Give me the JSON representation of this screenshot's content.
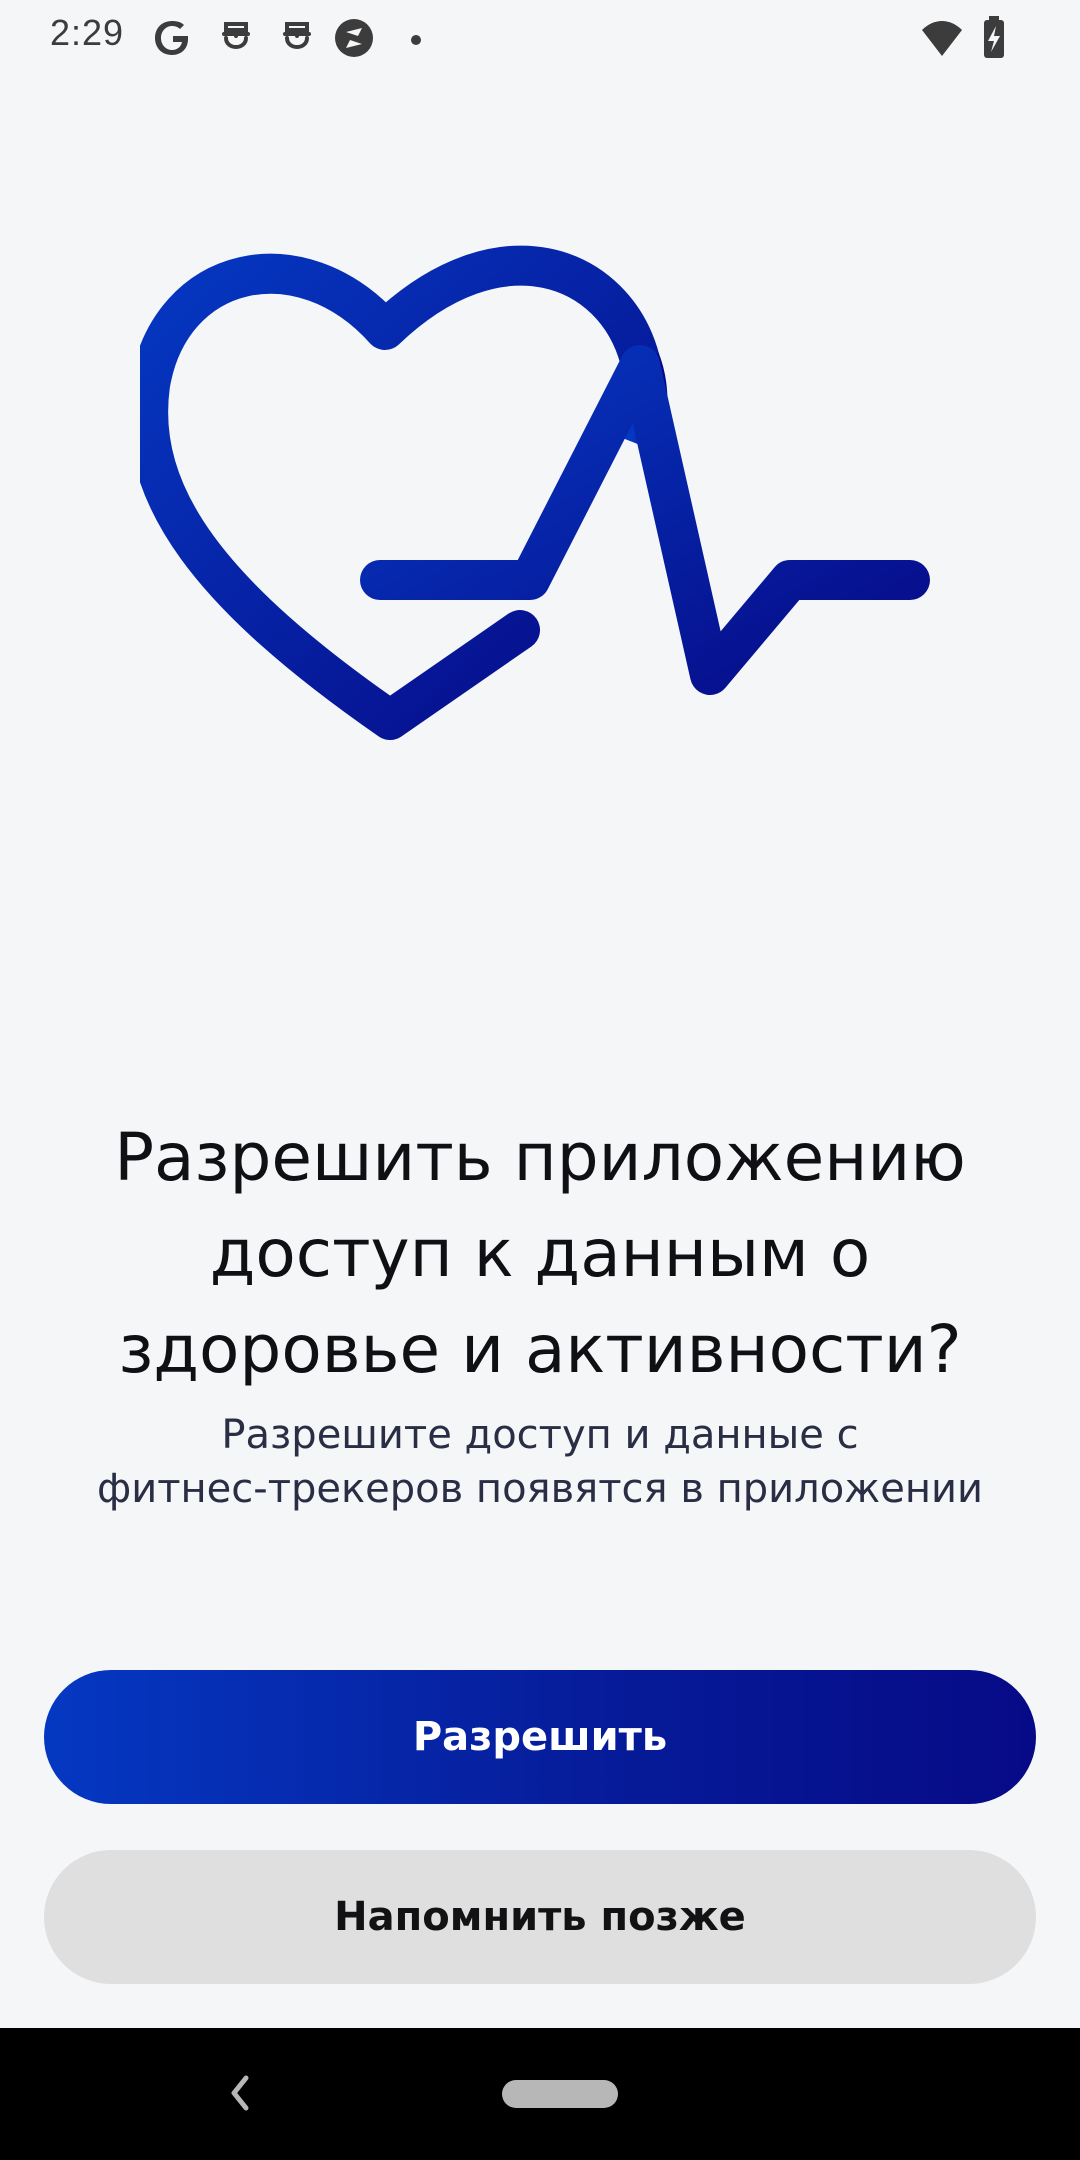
{
  "status_bar": {
    "time": "2:29",
    "icons": [
      "google-icon",
      "notification-icon",
      "notification-icon",
      "camera-app-icon",
      "dot-icon",
      "wifi-icon",
      "battery-charging-icon"
    ]
  },
  "hero": {
    "icon": "heart-pulse-icon",
    "gradient_start": "#0538c2",
    "gradient_end": "#070a86"
  },
  "dialog": {
    "title_line1": "Разрешить приложению",
    "title_line2": "доступ к данным о",
    "title_line3": "здоровье и активности?",
    "subtitle_line1": "Разрешите доступ и данные с",
    "subtitle_line2": "фитнес-трекеров появятся в приложении"
  },
  "actions": {
    "allow_label": "Разрешить",
    "later_label": "Напомнить позже"
  },
  "colors": {
    "primary_start": "#0538c2",
    "primary_end": "#070a86",
    "secondary_bg": "#dfdfe0",
    "background": "#f5f6f8"
  },
  "nav_bar": {
    "icons": [
      "back-icon",
      "home-pill-icon"
    ]
  }
}
